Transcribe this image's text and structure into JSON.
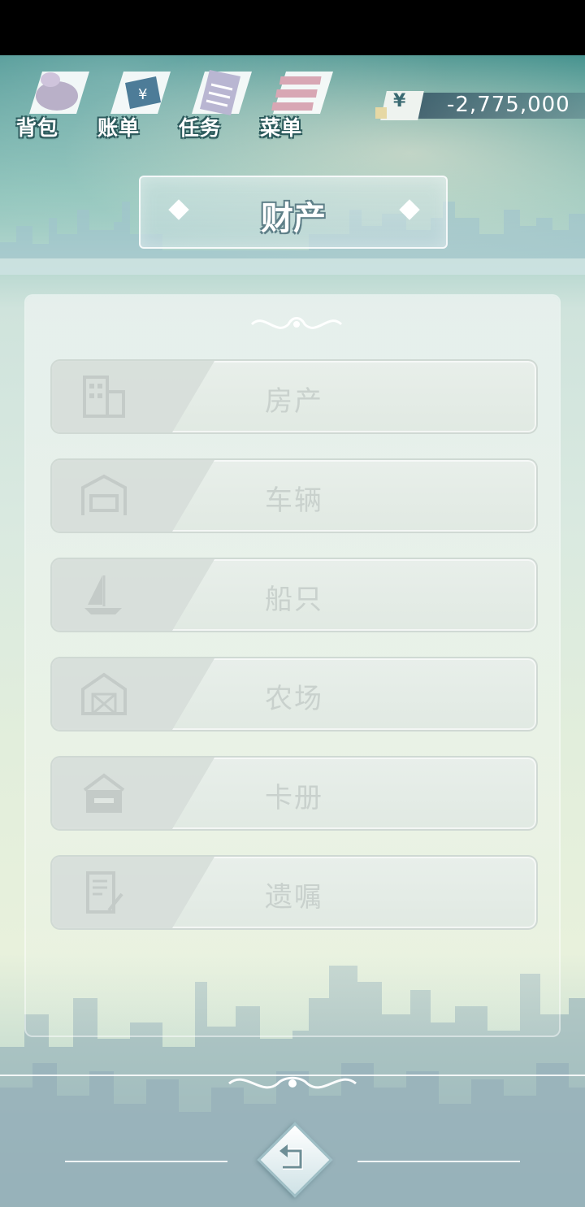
{
  "topbar": {
    "icons": [
      {
        "name": "backpack",
        "label": "背包"
      },
      {
        "name": "bill",
        "label": "账单"
      },
      {
        "name": "task",
        "label": "任务"
      },
      {
        "name": "menu",
        "label": "菜单"
      }
    ],
    "money": {
      "currency_symbol": "¥",
      "value": "-2,775,000"
    }
  },
  "title": "财产",
  "property_items": [
    {
      "label": "房产",
      "icon": "building-icon"
    },
    {
      "label": "车辆",
      "icon": "garage-icon"
    },
    {
      "label": "船只",
      "icon": "sailboat-icon"
    },
    {
      "label": "农场",
      "icon": "barn-icon"
    },
    {
      "label": "卡册",
      "icon": "card-box-icon"
    },
    {
      "label": "遗嘱",
      "icon": "will-document-icon"
    }
  ],
  "colors": {
    "label_outline": "#2d5b5d",
    "item_text": "#c9d1cd"
  }
}
